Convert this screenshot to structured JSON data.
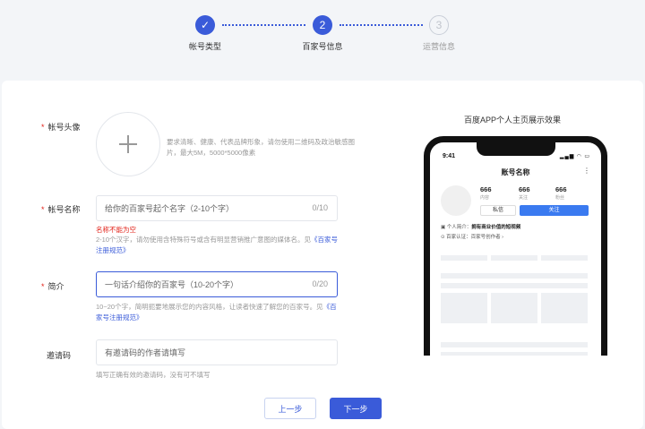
{
  "stepper": {
    "steps": [
      {
        "label": "帐号类型",
        "state": "done",
        "marker": "✓"
      },
      {
        "label": "百家号信息",
        "state": "active",
        "marker": "2"
      },
      {
        "label": "运营信息",
        "state": "todo",
        "marker": "3"
      }
    ]
  },
  "form": {
    "avatar": {
      "label": "帐号头像",
      "required": "*",
      "hint": "要求清晰、健康、代表品牌形象，请勿使用二维码及政治敏感图片，最大5M，5000*5000像素"
    },
    "name": {
      "label": "帐号名称",
      "required": "*",
      "placeholder": "给你的百家号起个名字（2-10个字）",
      "count": "0/10",
      "error": "名称不能为空",
      "hint": "2-10个汉字，请勿使用含特殊符号或含有明显营销推广意图的媒体名。见",
      "hint_link": "《百家号注册规范》"
    },
    "intro": {
      "label": "简介",
      "required": "*",
      "placeholder": "一句话介绍你的百家号（10-20个字）",
      "count": "0/20",
      "hint": "10~20个字，简明扼要地展示您的内容风格，让读者快速了解您的百家号。见",
      "hint_link": "《百家号注册规范》"
    },
    "invite": {
      "label": "邀请码",
      "placeholder": "有邀请码的作者请填写",
      "hint": "填写正确有效的邀请码，没有可不填写"
    }
  },
  "buttons": {
    "prev": "上一步",
    "next": "下一步"
  },
  "preview": {
    "title": "百度APP个人主页展示效果",
    "status_time": "9:41",
    "status_icons": "▂▄▆ ◠ ▭",
    "account_name": "账号名称",
    "more": "⋮",
    "stats": [
      {
        "num": "666",
        "label": "内容"
      },
      {
        "num": "666",
        "label": "关注"
      },
      {
        "num": "666",
        "label": "粉丝"
      }
    ],
    "message_btn": "私信",
    "follow_btn": "关注",
    "intro_label": "个人简介：",
    "intro_value": "拥有商业价值的短视频",
    "cert_label": "百家认证：",
    "cert_value": "百家号创作者 ›"
  },
  "colors": {
    "accent": "#3a5bd9",
    "error": "#e2231a",
    "follow": "#3a7af0"
  }
}
